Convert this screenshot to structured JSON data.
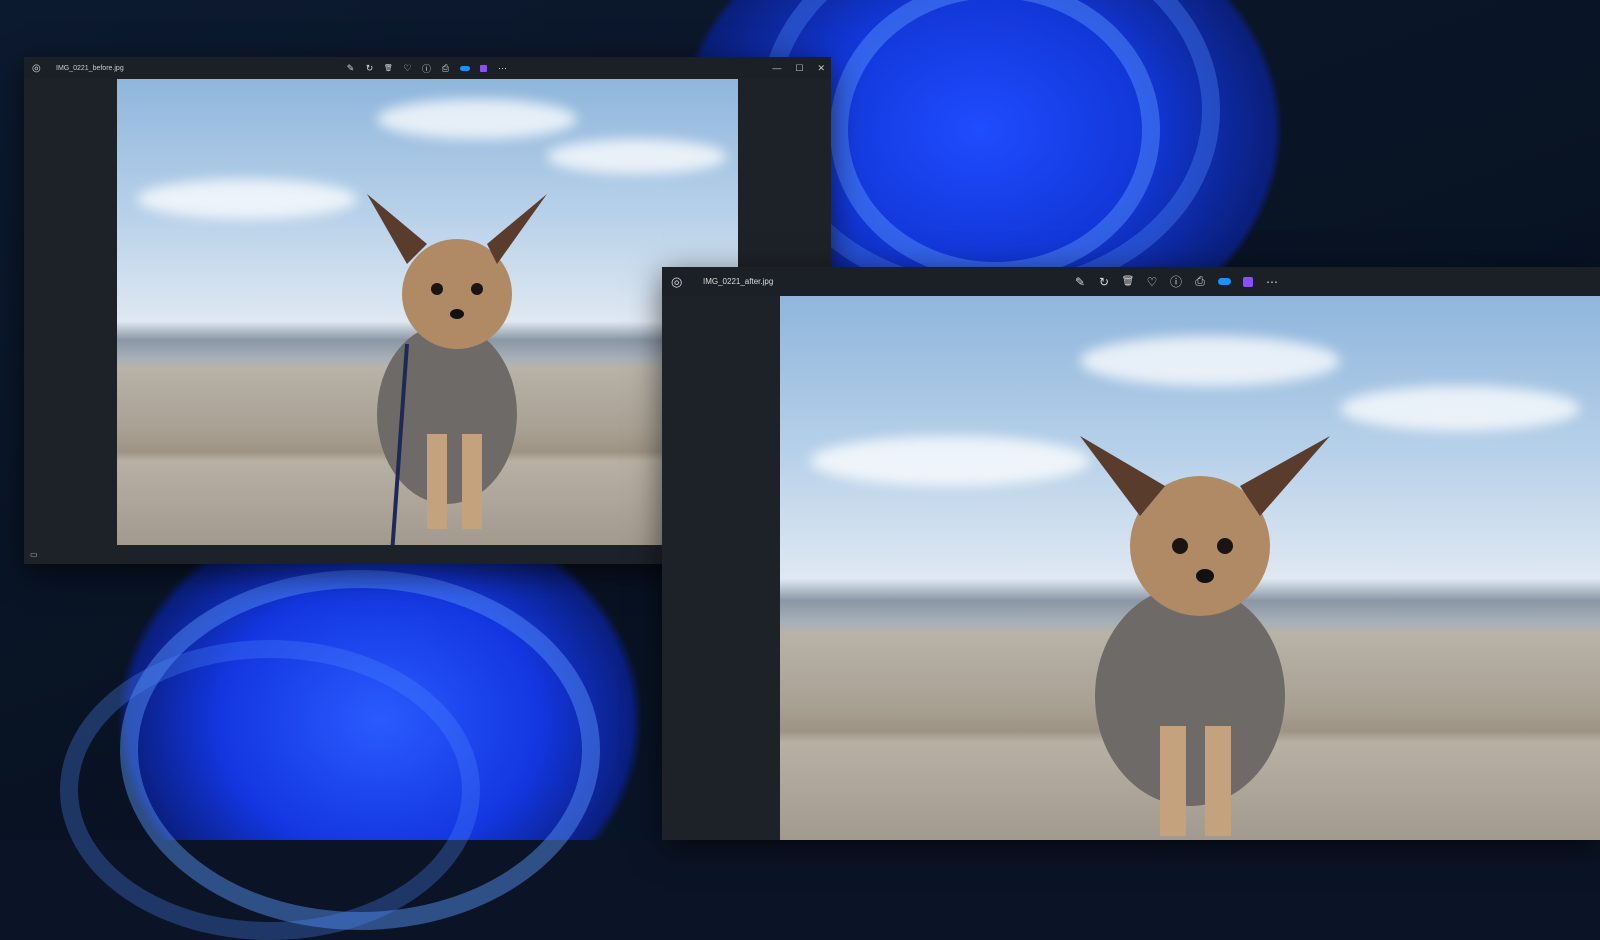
{
  "windows": [
    {
      "title": "IMG_0221_before.jpg"
    },
    {
      "title": "IMG_0221_after.jpg"
    }
  ],
  "toolbar_icons": [
    "edit-icon",
    "rotate-icon",
    "delete-icon",
    "favorite-icon",
    "info-icon",
    "print-icon",
    "onedrive-icon",
    "clipchamp-icon",
    "more-icon"
  ],
  "glyphs": {
    "edit": "✎",
    "rotate": "↻",
    "delete": "🗑",
    "favorite": "♡",
    "info": "ⓘ",
    "print": "⎙",
    "more": "⋯",
    "minimize": "—",
    "maximize": "☐",
    "close": "✕",
    "app": "◎",
    "monitor": "▭"
  },
  "colors": {
    "accent": "#1f4cff",
    "onedrive": "#1e90ff",
    "clipchamp": "#8a4dff"
  }
}
